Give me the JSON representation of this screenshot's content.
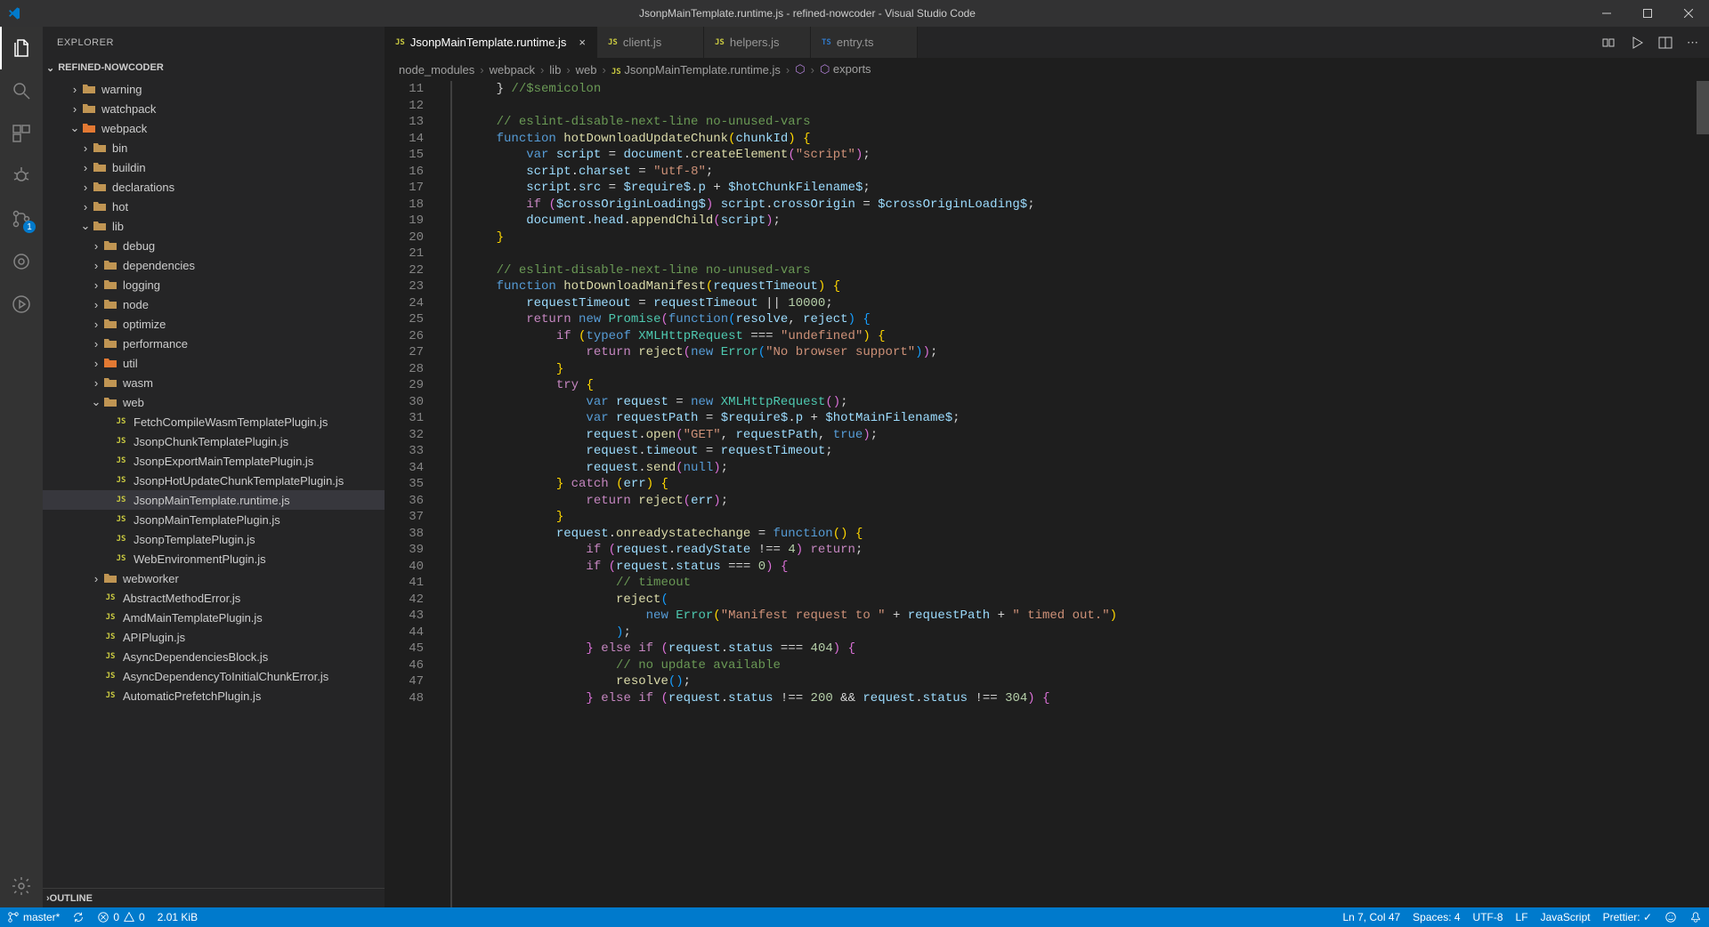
{
  "title": "JsonpMainTemplate.runtime.js - refined-nowcoder - Visual Studio Code",
  "explorer": {
    "title": "EXPLORER",
    "project": "REFINED-NOWCODER",
    "outline": "OUTLINE"
  },
  "tree": [
    {
      "type": "folder",
      "name": "warning",
      "depth": 2,
      "expanded": false
    },
    {
      "type": "folder",
      "name": "watchpack",
      "depth": 2,
      "expanded": false
    },
    {
      "type": "folder",
      "name": "webpack",
      "depth": 2,
      "expanded": true,
      "iconcolor": "#e37933"
    },
    {
      "type": "folder",
      "name": "bin",
      "depth": 3,
      "expanded": false
    },
    {
      "type": "folder",
      "name": "buildin",
      "depth": 3,
      "expanded": false
    },
    {
      "type": "folder",
      "name": "declarations",
      "depth": 3,
      "expanded": false
    },
    {
      "type": "folder",
      "name": "hot",
      "depth": 3,
      "expanded": false
    },
    {
      "type": "folder",
      "name": "lib",
      "depth": 3,
      "expanded": true
    },
    {
      "type": "folder",
      "name": "debug",
      "depth": 4,
      "expanded": false
    },
    {
      "type": "folder",
      "name": "dependencies",
      "depth": 4,
      "expanded": false
    },
    {
      "type": "folder",
      "name": "logging",
      "depth": 4,
      "expanded": false
    },
    {
      "type": "folder",
      "name": "node",
      "depth": 4,
      "expanded": false
    },
    {
      "type": "folder",
      "name": "optimize",
      "depth": 4,
      "expanded": false
    },
    {
      "type": "folder",
      "name": "performance",
      "depth": 4,
      "expanded": false
    },
    {
      "type": "folder",
      "name": "util",
      "depth": 4,
      "expanded": false,
      "iconcolor": "#e37933"
    },
    {
      "type": "folder",
      "name": "wasm",
      "depth": 4,
      "expanded": false
    },
    {
      "type": "folder",
      "name": "web",
      "depth": 4,
      "expanded": true
    },
    {
      "type": "file",
      "name": "FetchCompileWasmTemplatePlugin.js",
      "depth": 5,
      "ext": "JS"
    },
    {
      "type": "file",
      "name": "JsonpChunkTemplatePlugin.js",
      "depth": 5,
      "ext": "JS"
    },
    {
      "type": "file",
      "name": "JsonpExportMainTemplatePlugin.js",
      "depth": 5,
      "ext": "JS"
    },
    {
      "type": "file",
      "name": "JsonpHotUpdateChunkTemplatePlugin.js",
      "depth": 5,
      "ext": "JS"
    },
    {
      "type": "file",
      "name": "JsonpMainTemplate.runtime.js",
      "depth": 5,
      "ext": "JS",
      "selected": true
    },
    {
      "type": "file",
      "name": "JsonpMainTemplatePlugin.js",
      "depth": 5,
      "ext": "JS"
    },
    {
      "type": "file",
      "name": "JsonpTemplatePlugin.js",
      "depth": 5,
      "ext": "JS"
    },
    {
      "type": "file",
      "name": "WebEnvironmentPlugin.js",
      "depth": 5,
      "ext": "JS"
    },
    {
      "type": "folder",
      "name": "webworker",
      "depth": 4,
      "expanded": false
    },
    {
      "type": "file",
      "name": "AbstractMethodError.js",
      "depth": 4,
      "ext": "JS"
    },
    {
      "type": "file",
      "name": "AmdMainTemplatePlugin.js",
      "depth": 4,
      "ext": "JS"
    },
    {
      "type": "file",
      "name": "APIPlugin.js",
      "depth": 4,
      "ext": "JS"
    },
    {
      "type": "file",
      "name": "AsyncDependenciesBlock.js",
      "depth": 4,
      "ext": "JS"
    },
    {
      "type": "file",
      "name": "AsyncDependencyToInitialChunkError.js",
      "depth": 4,
      "ext": "JS"
    },
    {
      "type": "file",
      "name": "AutomaticPrefetchPlugin.js",
      "depth": 4,
      "ext": "JS"
    }
  ],
  "tabs": [
    {
      "name": "JsonpMainTemplate.runtime.js",
      "ext": "JS",
      "active": true,
      "close": true
    },
    {
      "name": "client.js",
      "ext": "JS",
      "active": false
    },
    {
      "name": "helpers.js",
      "ext": "JS",
      "active": false
    },
    {
      "name": "entry.ts",
      "ext": "TS",
      "active": false
    }
  ],
  "breadcrumbs": [
    "node_modules",
    "webpack",
    "lib",
    "web",
    "JsonpMainTemplate.runtime.js",
    "<unknown>",
    "exports"
  ],
  "lineStart": 11,
  "lineEnd": 48,
  "statusbar": {
    "branch": "master*",
    "errors": "0",
    "warnings": "0",
    "size": "2.01 KiB",
    "cursor": "Ln 7, Col 47",
    "spaces": "Spaces: 4",
    "encoding": "UTF-8",
    "eol": "LF",
    "lang": "JavaScript",
    "prettier": "Prettier: ✓"
  },
  "scm_badge": "1"
}
